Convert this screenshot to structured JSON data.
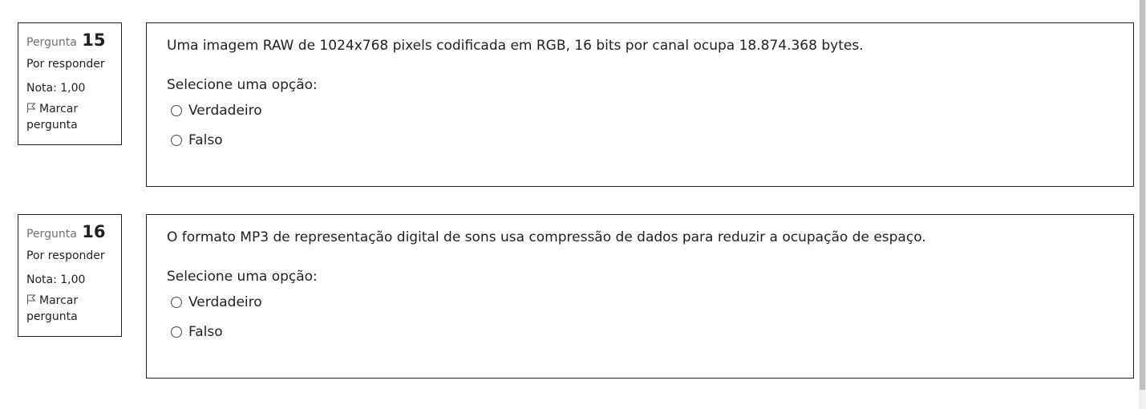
{
  "questions": [
    {
      "label": "Pergunta",
      "number": "15",
      "state": "Por responder",
      "grade": "Nota: 1,00",
      "flag_line1": "Marcar",
      "flag_line2": "pergunta",
      "text": "Uma imagem RAW de 1024x768 pixels codificada em RGB, 16 bits por canal ocupa 18.874.368 bytes.",
      "prompt": "Selecione uma opção:",
      "options": [
        "Verdadeiro",
        "Falso"
      ]
    },
    {
      "label": "Pergunta",
      "number": "16",
      "state": "Por responder",
      "grade": "Nota: 1,00",
      "flag_line1": "Marcar",
      "flag_line2": "pergunta",
      "text": "O formato MP3 de representação digital de sons usa compressão de dados para reduzir a ocupação de espaço.",
      "prompt": "Selecione uma opção:",
      "options": [
        "Verdadeiro",
        "Falso"
      ]
    }
  ]
}
